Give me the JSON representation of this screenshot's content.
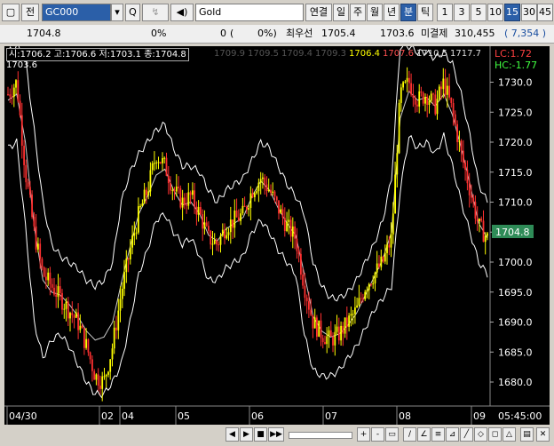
{
  "toolbar": {
    "view_label": "전",
    "symbol_code": "GC000",
    "search_label": "Q",
    "name": "Gold",
    "modes": [
      "연결",
      "일",
      "주",
      "월",
      "년",
      "분",
      "틱"
    ],
    "intervals": [
      "1",
      "3",
      "5",
      "10",
      "15",
      "30",
      "45"
    ],
    "active_mode": "분",
    "active_interval": "15"
  },
  "quote": {
    "price": "1704.8",
    "change_pct": "0%",
    "change_a": "0",
    "change_b": "0%)",
    "best_label": "최우선",
    "best_ask": "1705.4",
    "best_bid": "1703.6",
    "open_interest_label": "미결제",
    "open_interest": "310,455",
    "oi_change": "7,354"
  },
  "chart_data": {
    "type": "line",
    "ohlc_label": "시:1706.2 고:1706.6 저:1703.1 종:1704.8",
    "current_label": "1703.6",
    "other_values": [
      "1709.9",
      "1709.5",
      "1709.4",
      "1709.3",
      "1706.4",
      "1707.6",
      "1710.5",
      "1717.7"
    ],
    "lc_label": "LC:1.72",
    "hc_label": "HC:-1.77",
    "last_price": "1704.8",
    "y_ticks": [
      "1730.0",
      "1725.0",
      "1720.0",
      "1715.0",
      "1710.0",
      "1705.0",
      "1700.0",
      "1695.0",
      "1690.0",
      "1685.0",
      "1680.0"
    ],
    "y_tick_values": [
      1730,
      1725,
      1720,
      1715,
      1710,
      1705,
      1700,
      1695,
      1690,
      1685,
      1680
    ],
    "ylim": [
      1676,
      1736
    ],
    "x_labels": [
      "04/30",
      "02",
      "04",
      "05",
      "06",
      "07",
      "08",
      "09"
    ],
    "time_label": "05:45:00",
    "series": [
      {
        "values": [
          1728,
          1730,
          1715,
          1705,
          1698,
          1696,
          1694,
          1692,
          1690,
          1686,
          1681,
          1680,
          1686,
          1695,
          1702,
          1708,
          1712,
          1718,
          1716,
          1712,
          1710,
          1711,
          1708,
          1704,
          1703,
          1706,
          1707,
          1708,
          1712,
          1714,
          1712,
          1709,
          1706,
          1704,
          1696,
          1690,
          1688,
          1687,
          1688,
          1690,
          1692,
          1696,
          1698,
          1700,
          1704,
          1728,
          1730,
          1727,
          1728,
          1726,
          1730,
          1725,
          1718,
          1712,
          1706,
          1704
        ]
      }
    ],
    "band_upper": [
      1735,
      1736,
      1734,
      1722,
      1710,
      1703,
      1701,
      1700,
      1699,
      1697,
      1696,
      1697,
      1700,
      1710,
      1715,
      1718,
      1720,
      1722,
      1723,
      1719,
      1716,
      1716,
      1715,
      1712,
      1710,
      1712,
      1713,
      1714,
      1717,
      1720,
      1719,
      1716,
      1713,
      1711,
      1708,
      1700,
      1696,
      1694,
      1694,
      1695,
      1697,
      1700,
      1703,
      1707,
      1714,
      1736,
      1736,
      1735,
      1735,
      1734,
      1735,
      1733,
      1728,
      1721,
      1713,
      1710
    ],
    "band_lower": [
      1719,
      1720,
      1706,
      1690,
      1684,
      1687,
      1688,
      1686,
      1683,
      1680,
      1678,
      1678,
      1680,
      1683,
      1690,
      1698,
      1702,
      1707,
      1708,
      1705,
      1703,
      1704,
      1701,
      1697,
      1697,
      1699,
      1700,
      1701,
      1705,
      1707,
      1705,
      1702,
      1700,
      1698,
      1688,
      1682,
      1681,
      1681,
      1682,
      1684,
      1686,
      1689,
      1692,
      1694,
      1696,
      1712,
      1721,
      1719,
      1720,
      1718,
      1721,
      1716,
      1710,
      1705,
      1700,
      1698
    ]
  },
  "bottom": {
    "nav_buttons": [
      "◀",
      "▶",
      "■",
      "▶▶"
    ],
    "zoom_buttons": [
      "+",
      "-",
      "✕"
    ]
  },
  "colors": {
    "candle_up": "#ffff00",
    "candle_down": "#ff3030",
    "band": "#ffffff",
    "last_price_bg": "#2e8b57",
    "lc": "#ff4040",
    "hc": "#40ff40"
  }
}
